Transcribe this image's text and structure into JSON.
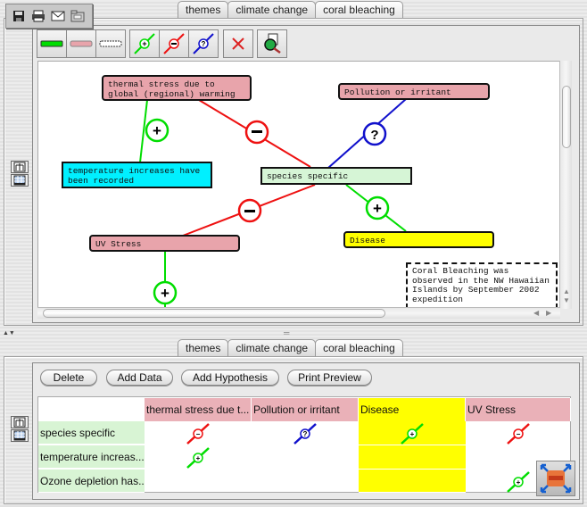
{
  "mini_toolbar": {
    "icons": [
      "save-icon",
      "print-icon",
      "email-icon",
      "folder-icon"
    ]
  },
  "tabs_top": [
    {
      "label": "themes",
      "active": false
    },
    {
      "label": "climate change",
      "active": false
    },
    {
      "label": "coral bleaching",
      "active": true
    }
  ],
  "tabs_bottom": [
    {
      "label": "themes",
      "active": false
    },
    {
      "label": "climate change",
      "active": false
    },
    {
      "label": "coral bleaching",
      "active": true
    }
  ],
  "toolbar": {
    "buttons": [
      {
        "name": "data-node-tool",
        "icon": "green-bar-icon"
      },
      {
        "name": "hypothesis-node-tool",
        "icon": "pink-bar-icon"
      },
      {
        "name": "note-node-tool",
        "icon": "dashed-bar-icon"
      },
      {
        "name": "supports-link-tool",
        "icon": "plus-link-icon"
      },
      {
        "name": "contradicts-link-tool",
        "icon": "minus-link-icon"
      },
      {
        "name": "unknown-link-tool",
        "icon": "question-link-icon"
      },
      {
        "name": "delete-tool",
        "icon": "red-x-icon"
      },
      {
        "name": "inspect-tool",
        "icon": "magnifier-document-icon"
      }
    ]
  },
  "colors": {
    "hypothesis": "#e8a4ab",
    "data_cyan": "#00f0ff",
    "data_mint": "#d6f5d6",
    "data_yellow": "#ffff00",
    "support": "#00dd00",
    "contradict": "#ee1111",
    "unknown": "#1111cc"
  },
  "concept_map": {
    "nodes": {
      "thermal": {
        "text": "thermal stress due to global (regional) warming",
        "line1": "thermal stress due to",
        "line2": "global (regional) warming",
        "kind": "hypothesis"
      },
      "pollution": {
        "text": "Pollution or irritant",
        "kind": "hypothesis"
      },
      "temperature": {
        "text": "temperature increases have been recorded",
        "line1": "temperature increases have",
        "line2": "been recorded",
        "kind": "data"
      },
      "species": {
        "text": "species specific",
        "kind": "data"
      },
      "uv": {
        "text": "UV Stress",
        "kind": "hypothesis"
      },
      "disease": {
        "text": "Disease",
        "kind": "hypothesis"
      },
      "note": {
        "line1": "Coral Bleaching was",
        "line2": "observed in the NW Hawaiian",
        "line3": "Islands by September 2002",
        "line4": "expedition",
        "kind": "note"
      }
    },
    "links": [
      {
        "from": "thermal",
        "to": "temperature",
        "type": "supports",
        "symbol": "+"
      },
      {
        "from": "thermal",
        "to": "species",
        "type": "contradicts",
        "symbol": "−"
      },
      {
        "from": "pollution",
        "to": "species",
        "type": "unknown",
        "symbol": "?"
      },
      {
        "from": "species",
        "to": "disease",
        "type": "supports",
        "symbol": "+"
      },
      {
        "from": "species",
        "to": "uv",
        "type": "contradicts",
        "symbol": "−"
      },
      {
        "from": "uv",
        "to": "offscreen",
        "type": "supports",
        "symbol": "+"
      }
    ]
  },
  "bottom_buttons": {
    "delete": "Delete",
    "add_data": "Add Data",
    "add_hypothesis": "Add Hypothesis",
    "print_preview": "Print Preview"
  },
  "table": {
    "columns": [
      "thermal stress due t...",
      "Pollution or irritant",
      "Disease",
      "UV Stress"
    ],
    "rows": [
      {
        "label": "species specific",
        "cells": [
          "contradicts",
          "unknown",
          "supports",
          "contradicts"
        ]
      },
      {
        "label": "temperature increas...",
        "cells": [
          "supports",
          "",
          "",
          ""
        ]
      },
      {
        "label": "Ozone depletion has...",
        "cells": [
          "",
          "",
          "",
          "supports"
        ]
      }
    ]
  }
}
